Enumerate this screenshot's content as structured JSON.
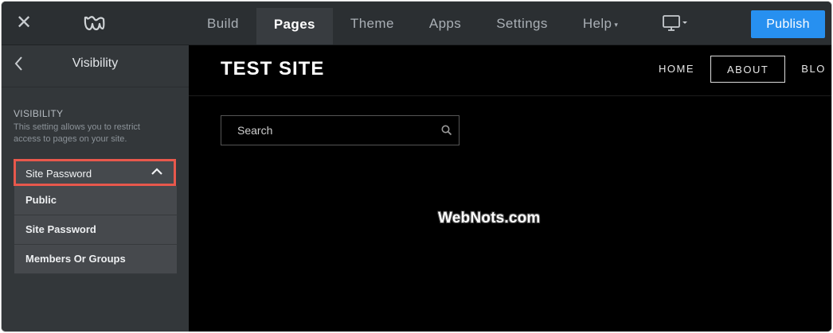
{
  "topbar": {
    "nav": [
      {
        "label": "Build"
      },
      {
        "label": "Pages"
      },
      {
        "label": "Theme"
      },
      {
        "label": "Apps"
      },
      {
        "label": "Settings"
      },
      {
        "label": "Help"
      }
    ],
    "publish_label": "Publish"
  },
  "sidebar": {
    "title": "Visibility",
    "section_label": "VISIBILITY",
    "section_desc": "This setting allows you to restrict access to pages on your site.",
    "selected": "Site Password",
    "options": [
      {
        "label": "Public"
      },
      {
        "label": "Site Password"
      },
      {
        "label": "Members Or Groups"
      }
    ]
  },
  "preview": {
    "site_title": "TEST SITE",
    "nav": [
      {
        "label": "HOME"
      },
      {
        "label": "ABOUT"
      },
      {
        "label": "BLO"
      }
    ],
    "search_placeholder": "Search",
    "watermark": "WebNots.com"
  },
  "colors": {
    "accent": "#2790f0",
    "highlight_border": "#e8584c",
    "topbar_bg": "#2b2f32",
    "sidebar_bg": "#33373a"
  },
  "icons": {
    "close": "close-icon",
    "logo": "weebly-logo-icon",
    "back": "chevron-left-icon",
    "collapse": "chevron-up-icon",
    "device": "monitor-icon",
    "search": "search-icon"
  }
}
